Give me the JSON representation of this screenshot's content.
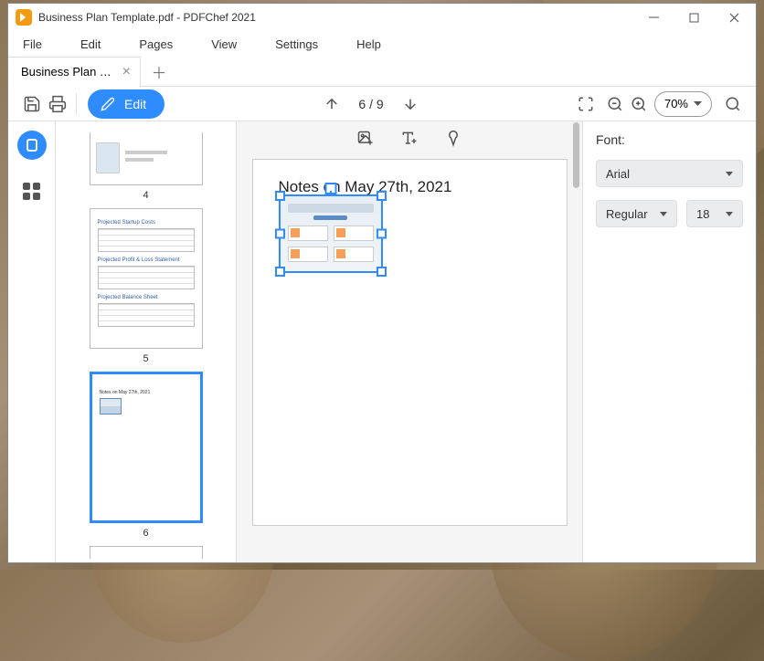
{
  "title": "Business Plan Template.pdf - PDFChef 2021",
  "menu": {
    "file": "File",
    "edit": "Edit",
    "pages": "Pages",
    "view": "View",
    "settings": "Settings",
    "help": "Help"
  },
  "tab": {
    "label": "Business Plan T..."
  },
  "toolbar": {
    "edit": "Edit",
    "page": "6 / 9",
    "zoom": "70%"
  },
  "thumbs": {
    "p4": "4",
    "p5": "5",
    "p6": "6",
    "t1": "Projected Startup Costs",
    "t2": "Projected Profit & Loss Statement",
    "t3": "Projected Balance Sheet",
    "tiny": "Notes on May 27th, 2021"
  },
  "page": {
    "notes": "Notes on May 27th, 2021"
  },
  "panel": {
    "font": "Font:",
    "family": "Arial",
    "weight": "Regular",
    "size": "18"
  }
}
